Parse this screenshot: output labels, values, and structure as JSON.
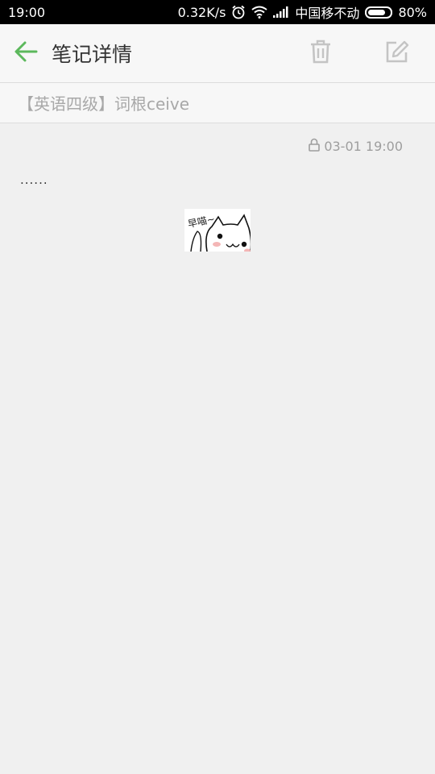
{
  "status_bar": {
    "time": "19:00",
    "network_speed": "0.32K/s",
    "carrier": "中国移不动",
    "battery_percent": "80%",
    "battery_level": 0.8,
    "icons": [
      "alarm-icon",
      "wifi-icon",
      "signal-icon",
      "battery-icon"
    ]
  },
  "app_bar": {
    "title": "笔记详情",
    "back_icon": "arrow-left-icon",
    "actions": [
      "trash-icon",
      "edit-icon"
    ],
    "accent_color": "#5cb85c"
  },
  "note": {
    "title": "【英语四级】词根ceive",
    "timestamp": "03-01 19:00",
    "lock_icon": "lock-icon",
    "content": "......",
    "image_caption": "早喵~"
  }
}
